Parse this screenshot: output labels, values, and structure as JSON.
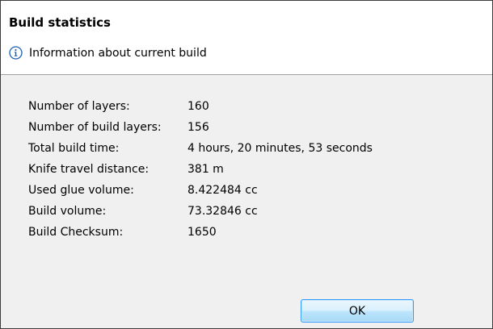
{
  "dialog": {
    "title": "Build statistics",
    "info_icon": "info-circle-icon",
    "info_text": "Information about current build"
  },
  "stats": [
    {
      "label": "Number of layers:",
      "value": "160"
    },
    {
      "label": "Number of build layers:",
      "value": "156"
    },
    {
      "label": "Total build time:",
      "value": "4 hours, 20 minutes, 53 seconds"
    },
    {
      "label": "Knife travel distance:",
      "value": "381 m"
    },
    {
      "label": "Used glue volume:",
      "value": "8.422484 cc"
    },
    {
      "label": "Build volume:",
      "value": "73.32846 cc"
    },
    {
      "label": "Build Checksum:",
      "value": "1650"
    }
  ],
  "buttons": {
    "ok_label": "OK"
  },
  "colors": {
    "info_icon": "#1c5fb3",
    "button_border": "#3399ff"
  }
}
